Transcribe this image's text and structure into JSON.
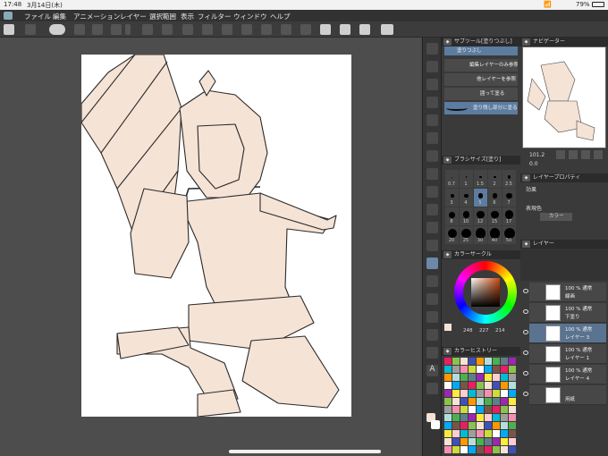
{
  "status": {
    "time": "17:48",
    "date": "3月14日(木)",
    "battery": "79%"
  },
  "menu": [
    "ファイル",
    "編集",
    "アニメーション",
    "レイヤー",
    "選択範囲",
    "表示",
    "フィルター",
    "ウィンドウ",
    "ヘルプ"
  ],
  "subtool": {
    "title": "サブツール[塗りつぶし]",
    "header": "塗りつぶし",
    "items": [
      "編集レイヤーのみ参照",
      "他レイヤーを参照",
      "囲って塗る",
      "塗り残し部分に塗る"
    ]
  },
  "navigator": {
    "title": "ナビゲーター",
    "zoom": "101.2",
    "angle": "0.0"
  },
  "brushsize": {
    "title": "ブラシサイズ[塗り]",
    "sizes": [
      "0.7",
      "1",
      "1.5",
      "2",
      "2.5",
      "3",
      "4",
      "5",
      "6",
      "7",
      "8",
      "10",
      "12",
      "15",
      "17",
      "20",
      "25",
      "30",
      "40",
      "50"
    ]
  },
  "layerprop": {
    "title": "レイヤープロパティ",
    "effect": "効果",
    "color_label": "表現色",
    "color_value": "カラー"
  },
  "colorcircle": {
    "title": "カラーサークル",
    "values": [
      "248",
      "227",
      "214"
    ],
    "accent": "#f8e3d6"
  },
  "colorhistory": {
    "title": "カラーヒストリー"
  },
  "layers": {
    "title": "レイヤー",
    "items": [
      {
        "l1": "100 % 通常",
        "l2": "線画"
      },
      {
        "l1": "100 % 通常",
        "l2": "下塗り"
      },
      {
        "l1": "100 % 通常",
        "l2": "レイヤー 3"
      },
      {
        "l1": "100 % 通常",
        "l2": "レイヤー 1"
      },
      {
        "l1": "100 % 通常",
        "l2": "レイヤー 4"
      },
      {
        "l1": "",
        "l2": "用紙"
      }
    ]
  },
  "colors": {
    "skin": "#f5e3d6",
    "line": "#2a2a2a",
    "panel": "#3a3a3a",
    "select": "#5c7ca0"
  },
  "icons": [
    "wifi-icon",
    "battery-icon",
    "eye-icon",
    "brush-icon",
    "eraser-icon",
    "fill-icon",
    "text-icon",
    "move-icon"
  ]
}
